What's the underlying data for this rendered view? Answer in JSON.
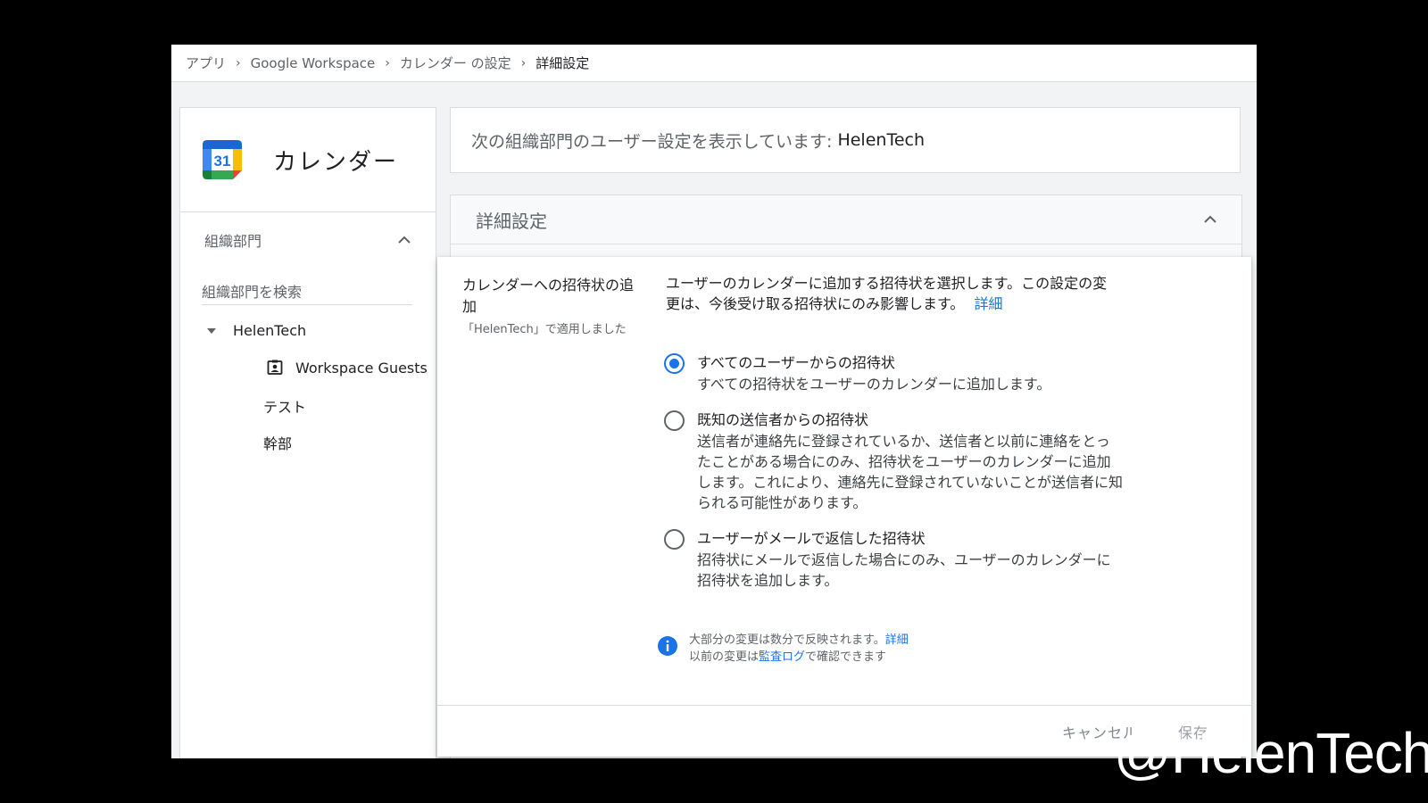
{
  "breadcrumb": {
    "items": [
      "アプリ",
      "Google Workspace",
      "カレンダー の設定"
    ],
    "current": "詳細設定",
    "separator": "›"
  },
  "sidebar": {
    "app_title": "カレンダー",
    "logo_number": "31",
    "ou_header": "組織部門",
    "search_placeholder": "組織部門を検索",
    "tree": {
      "root": "HelenTech",
      "guests": "Workspace Guests",
      "child1": "テスト",
      "child2": "幹部"
    }
  },
  "banner": {
    "prefix": "次の組織部門のユーザー設定を表示しています:",
    "org": "HelenTech"
  },
  "section": {
    "title": "詳細設定"
  },
  "setting": {
    "label": "カレンダーへの招待状の追加",
    "applied": "「HelenTech」で適用しました",
    "description": "ユーザーのカレンダーに追加する招待状を選択します。この設定の変更は、今後受け取る招待状にのみ影響します。",
    "details_link": "詳細",
    "options": [
      {
        "title": "すべてのユーザーからの招待状",
        "desc": "すべての招待状をユーザーのカレンダーに追加します。",
        "checked": true
      },
      {
        "title": "既知の送信者からの招待状",
        "desc": "送信者が連絡先に登録されているか、送信者と以前に連絡をとったことがある場合にのみ、招待状をユーザーのカレンダーに追加します。これにより、連絡先に登録されていないことが送信者に知られる可能性があります。",
        "checked": false
      },
      {
        "title": "ユーザーがメールで返信した招待状",
        "desc": "招待状にメールで返信した場合にのみ、ユーザーのカレンダーに招待状を追加します。",
        "checked": false
      }
    ]
  },
  "info": {
    "line1": "大部分の変更は数分で反映されます。",
    "line1_link": "詳細",
    "line2_prefix": "以前の変更は",
    "line2_link": "監査ログ",
    "line2_suffix": "で確認できます"
  },
  "footer": {
    "cancel": "キャンセル",
    "save": "保存"
  },
  "watermark": "@HelenTech",
  "colors": {
    "accent": "#1a73e8",
    "text": "#202124",
    "secondary": "#5f6368"
  }
}
